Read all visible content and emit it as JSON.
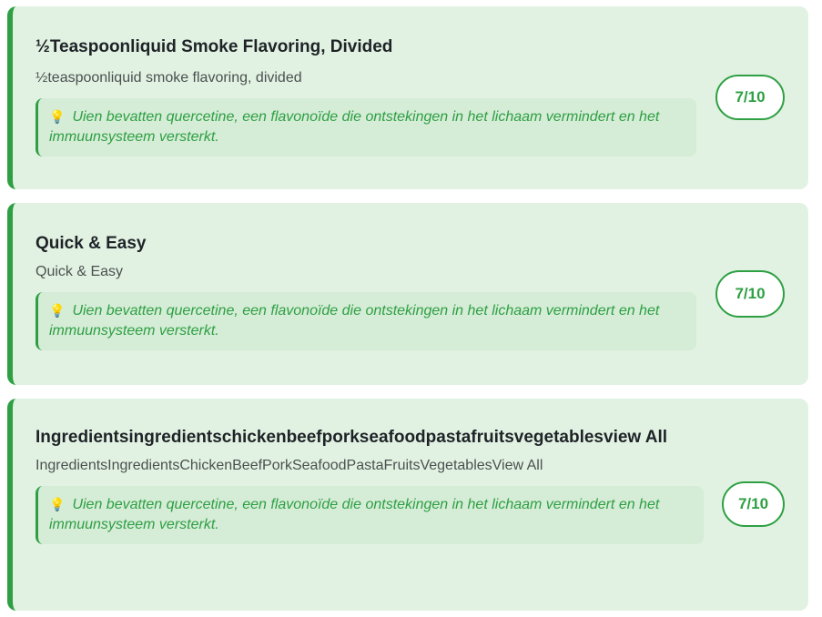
{
  "items": [
    {
      "title": "½Teaspoonliquid Smoke Flavoring, Divided",
      "subtitle": "½teaspoonliquid smoke flavoring, divided",
      "tip_icon": "lightbulb-icon",
      "tip": "Uien bevatten quercetine, een flavonoïde die ontstekingen in het lichaam vermindert en het immuunsysteem versterkt.",
      "score": "7/10"
    },
    {
      "title": "Quick & Easy",
      "subtitle": "Quick & Easy",
      "tip_icon": "lightbulb-icon",
      "tip": "Uien bevatten quercetine, een flavonoïde die ontstekingen in het lichaam vermindert en het immuunsysteem versterkt.",
      "score": "7/10"
    },
    {
      "title": "Ingredientsingredientschickenbeefporkseafoodpastafruitsvegetablesview All",
      "subtitle": "IngredientsIngredientsChickenBeefPorkSeafoodPastaFruitsVegetablesView All",
      "tip_icon": "lightbulb-icon",
      "tip": "Uien bevatten quercetine, een flavonoïde die ontstekingen in het lichaam vermindert en het immuunsysteem versterkt.",
      "score": "7/10"
    }
  ],
  "colors": {
    "accent": "#2ea043",
    "card_bg": "#e1f2e2",
    "tip_bg": "#d5ecd7"
  }
}
